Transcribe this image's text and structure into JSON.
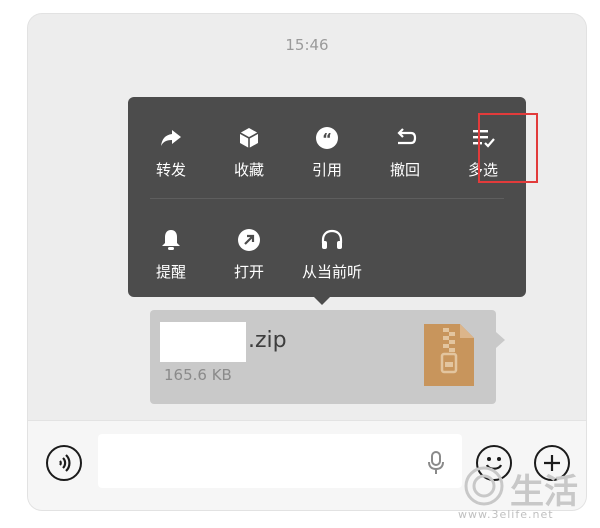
{
  "chat": {
    "time": "15:46"
  },
  "menu": {
    "row1": [
      {
        "label": "转发",
        "icon": "forward-icon"
      },
      {
        "label": "收藏",
        "icon": "favorite-cube-icon"
      },
      {
        "label": "引用",
        "icon": "quote-icon"
      },
      {
        "label": "撤回",
        "icon": "recall-undo-icon",
        "highlighted": true
      },
      {
        "label": "多选",
        "icon": "multi-select-icon"
      }
    ],
    "row2": [
      {
        "label": "提醒",
        "icon": "bell-icon"
      },
      {
        "label": "打开",
        "icon": "open-arrow-icon"
      },
      {
        "label": "从当前听",
        "icon": "headphones-icon"
      }
    ],
    "highlight_color": "#e23b3b"
  },
  "file": {
    "name": ".zip",
    "size": "165.6 KB",
    "icon": "zip-archive-icon",
    "icon_color": "#c8955c"
  },
  "inputbar": {
    "voice": "voice-icon",
    "mic": "microphone-icon",
    "emoji": "emoji-icon",
    "plus": "plus-icon"
  },
  "watermark": {
    "text": "生活",
    "url": "www.3elife.net"
  }
}
